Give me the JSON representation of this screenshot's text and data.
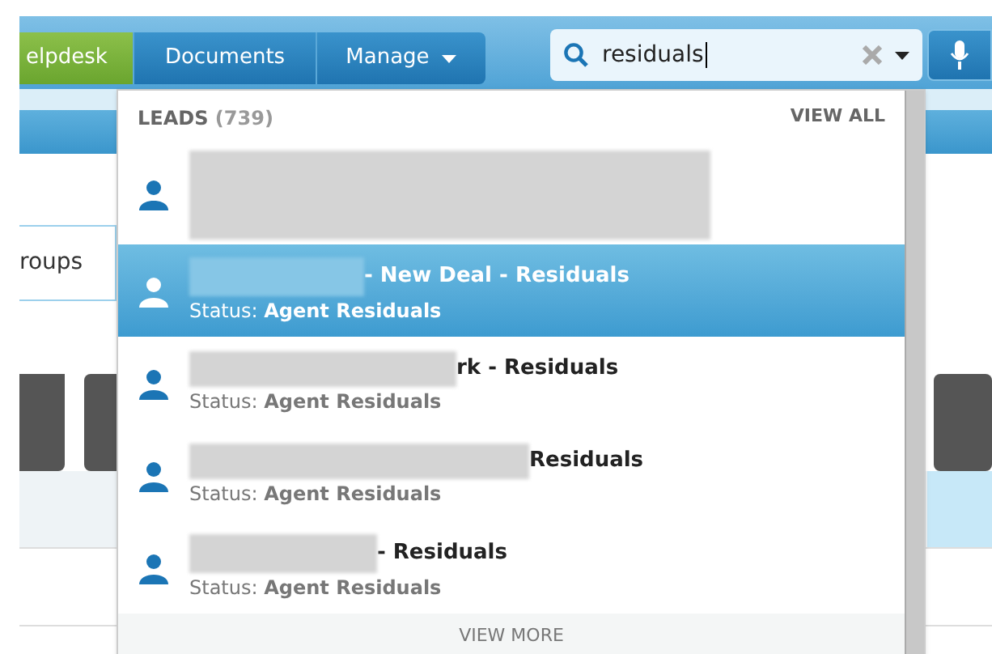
{
  "nav": {
    "tabs": [
      {
        "label": "elpdesk",
        "kind": "green"
      },
      {
        "label": "Documents",
        "kind": "blue"
      },
      {
        "label": "Manage",
        "kind": "menu"
      }
    ]
  },
  "search": {
    "value": "residuals"
  },
  "background": {
    "tab_label": "roups"
  },
  "dropdown": {
    "section": "LEADS",
    "count": "(739)",
    "view_all": "VIEW ALL",
    "view_more": "VIEW MORE",
    "items": [
      {
        "selected": false
      },
      {
        "title": "- New Deal - Residuals",
        "status": "Status: **Agent Residuals**",
        "selected": true
      },
      {
        "title": "rk - Residuals",
        "status": "Status: **Agent Residuals**",
        "selected": false
      },
      {
        "title": "Residuals",
        "status": "Status: **Agent Residuals**",
        "selected": false
      },
      {
        "title": "- Residuals",
        "status": "Status: **Agent Residuals**",
        "selected": false
      }
    ]
  }
}
